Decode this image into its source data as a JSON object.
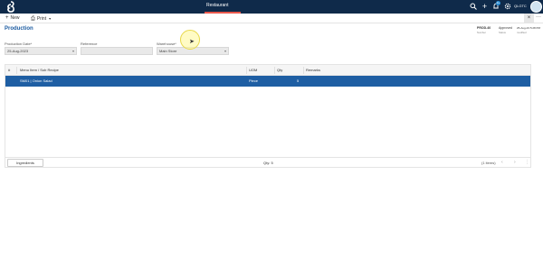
{
  "topbar": {
    "app_title": "Restaurant",
    "user_code": "QLGTC",
    "notification_count": "9+"
  },
  "toolbar": {
    "new_label": "New",
    "print_label": "Print",
    "close_label": "×",
    "more_label": "···"
  },
  "page": {
    "title": "Production"
  },
  "meta": {
    "doc_no": "PROD-40",
    "doc_no_sub": "Number",
    "status": "Approved",
    "status_sub": "Status",
    "modified": "25-Aug-23 5:28 PM",
    "modified_sub": "modified"
  },
  "form": {
    "production_date_label": "Production Date*",
    "production_date_value": "25-Aug-2023",
    "reference_label": "Reference",
    "reference_value": "",
    "warehouse_label": "Warehouse*",
    "warehouse_value": "Main Store"
  },
  "grid": {
    "columns": [
      "#",
      "Menu Item / Sub Recipe",
      "UOM",
      "Qty",
      "Remarks"
    ],
    "rows": [
      {
        "index": "1",
        "item": "SM01 | Onion Salad",
        "uom": "Piece",
        "qty": "5",
        "remarks": ""
      }
    ]
  },
  "footer": {
    "ingredients_label": "Ingredients",
    "qty_total": "Qty: 5",
    "items_count": "(1 items)"
  },
  "icons": {
    "logo": "logo-icon",
    "search": "search-icon",
    "add": "plus-icon",
    "notifications": "bell-icon",
    "settings": "gear-icon"
  },
  "colors": {
    "topbar": "#0f2a4a",
    "accent": "#e8584c",
    "selected_row": "#1e5ea3",
    "title": "#1a5aa0"
  }
}
